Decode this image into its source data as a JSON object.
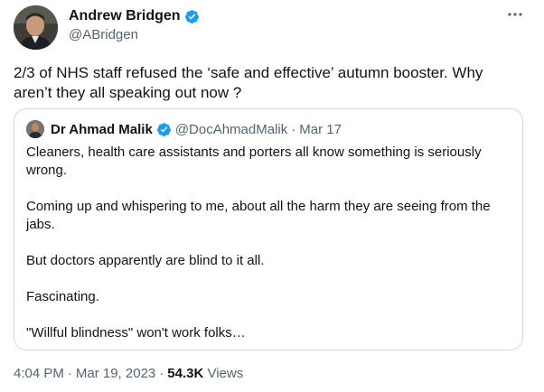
{
  "author": {
    "display_name": "Andrew Bridgen",
    "handle": "@ABridgen",
    "avatar_icon": "user-photo-icon",
    "verified_color": "#1d9bf0"
  },
  "tweet": {
    "text": "2/3 of NHS staff refused the ‘safe and effective’ autumn booster. Why aren’t they all speaking out now ?"
  },
  "quoted": {
    "display_name": "Dr Ahmad Malik",
    "handle": "@DocAhmadMalik",
    "separator": "·",
    "date": "Mar 17",
    "paragraphs": [
      "Cleaners, health care assistants and porters all  know something is seriously wrong.",
      "Coming up and whispering to me, about all the harm they are seeing from the jabs.",
      "But doctors apparently are blind to it all.",
      "Fascinating.",
      "\"Willful blindness\" won't work folks…"
    ]
  },
  "meta": {
    "time": "4:04 PM",
    "sep1": "·",
    "date": "Mar 19, 2023",
    "sep2": "·",
    "views_count": "54.3K",
    "views_label": "Views"
  },
  "more_icon": "more-options-icon"
}
